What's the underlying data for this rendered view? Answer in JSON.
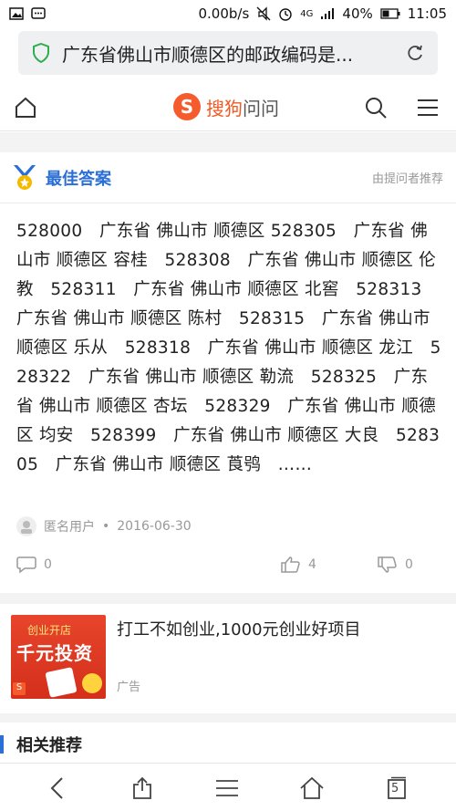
{
  "status_bar": {
    "speed": "0.00b/s",
    "network": "4G",
    "battery": "40%",
    "time": "11:05"
  },
  "browser": {
    "url_text": "广东省佛山市顺德区的邮政编码是..."
  },
  "site": {
    "logo_letter": "S",
    "brand_name_1": "搜狗",
    "brand_name_2": "问问"
  },
  "best_answer": {
    "title": "最佳答案",
    "recommended_by": "由提问者推荐",
    "text": "528000   广东省 佛山市 顺德区 528305   广东省 佛山市 顺德区 容桂   528308   广东省 佛山市 顺德区 伦教   528311   广东省 佛山市 顺德区 北窖   528313   广东省 佛山市 顺德区 陈村   528315   广东省 佛山市 顺德区 乐从   528318   广东省 佛山市 顺德区 龙江   528322   广东省 佛山市 顺德区 勒流   528325   广东省 佛山市 顺德区 杏坛   528329   广东省 佛山市 顺德区 均安   528399   广东省 佛山市 顺德区 大良   528305   广东省 佛山市 顺德区 莨鸮   ……",
    "user": "匿名用户",
    "date": "2016-06-30",
    "comments": "0",
    "likes": "4",
    "dislikes": "0"
  },
  "ad": {
    "image_text_1": "创业开店",
    "image_text_2": "千元投资",
    "title": "打工不如创业,1000元创业好项目",
    "label": "广告"
  },
  "related": {
    "title": "相关推荐"
  },
  "toolbar": {
    "tabs_count": "5"
  }
}
